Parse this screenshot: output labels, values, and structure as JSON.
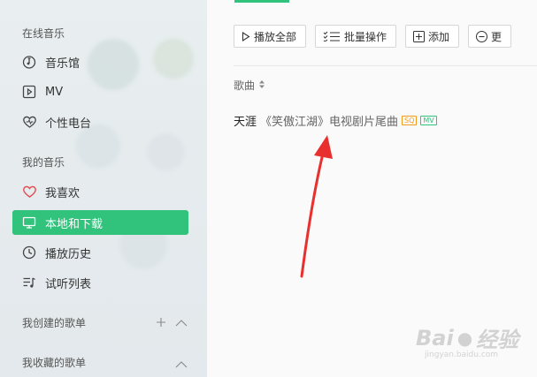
{
  "sidebar": {
    "online_title": "在线音乐",
    "online_items": [
      {
        "label": "音乐馆",
        "icon": "music-hall-icon"
      },
      {
        "label": "MV",
        "icon": "mv-play-icon"
      },
      {
        "label": "个性电台",
        "icon": "heart-radio-icon"
      }
    ],
    "my_title": "我的音乐",
    "my_items": [
      {
        "label": "我喜欢",
        "icon": "heart-icon"
      },
      {
        "label": "本地和下载",
        "icon": "monitor-icon",
        "active": true
      },
      {
        "label": "播放历史",
        "icon": "clock-icon"
      },
      {
        "label": "试听列表",
        "icon": "playlist-icon"
      }
    ],
    "created_title": "我创建的歌单",
    "collected_title": "我收藏的歌单"
  },
  "toolbar": {
    "play_all": "播放全部",
    "batch": "批量操作",
    "add": "添加",
    "more": "更"
  },
  "list": {
    "column_song": "歌曲",
    "songs": [
      {
        "title": "天涯",
        "subtitle": "《笑傲江湖》电视剧片尾曲",
        "badges": [
          "SQ",
          "MV"
        ]
      }
    ]
  },
  "watermark": {
    "brand": "Bai",
    "brand2": "经验",
    "sub": "jingyan.baidu.com"
  },
  "colors": {
    "accent": "#31c27c",
    "arrow": "#e8302e",
    "sq_badge": "#f09c16"
  }
}
